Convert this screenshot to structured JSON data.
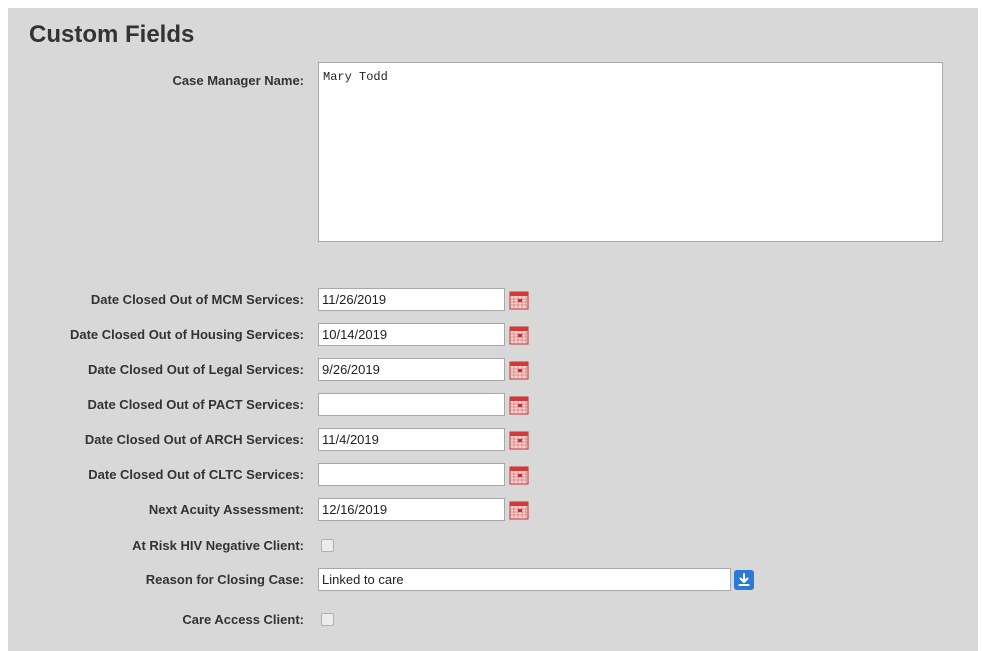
{
  "section": {
    "title": "Custom Fields"
  },
  "case_manager": {
    "label": "Case Manager Name:",
    "value": "Mary Todd"
  },
  "date_fields": [
    {
      "label": "Date Closed Out of MCM Services:",
      "value": "11/26/2019"
    },
    {
      "label": "Date Closed Out of Housing Services:",
      "value": "10/14/2019"
    },
    {
      "label": "Date Closed Out of Legal Services:",
      "value": "9/26/2019"
    },
    {
      "label": "Date Closed Out of PACT Services:",
      "value": ""
    },
    {
      "label": "Date Closed Out of ARCH Services:",
      "value": "11/4/2019"
    },
    {
      "label": "Date Closed Out of CLTC Services:",
      "value": ""
    },
    {
      "label": "Next Acuity Assessment:",
      "value": "12/16/2019"
    }
  ],
  "at_risk": {
    "label": "At Risk HIV Negative Client:",
    "checked": false
  },
  "reason_closing": {
    "label": "Reason for Closing Case:",
    "value": "Linked to care"
  },
  "care_access": {
    "label": "Care Access Client:",
    "checked": false
  },
  "colors": {
    "panel_bg": "#d8d8d8",
    "accent_button": "#2a7ad6",
    "calendar_red": "#d23a3a"
  },
  "icons": {
    "calendar": "calendar-icon",
    "dropdown": "download-arrow-icon"
  }
}
